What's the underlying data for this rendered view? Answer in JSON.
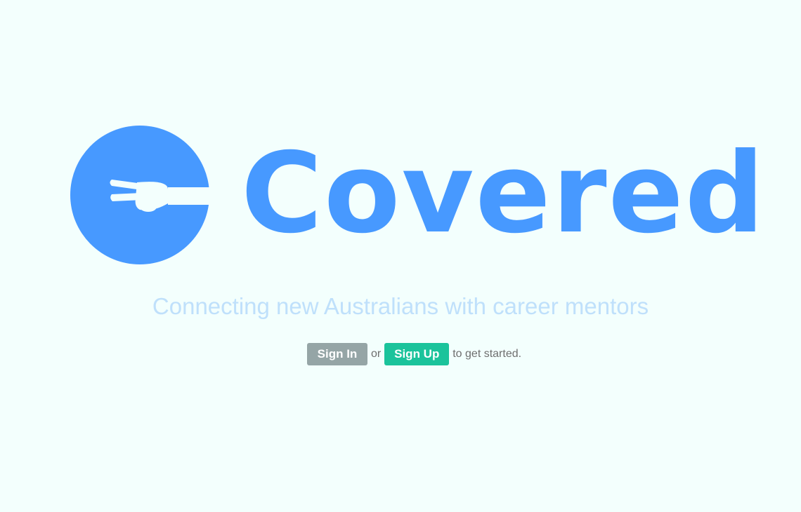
{
  "brand": {
    "name": "Covered",
    "logo_icon": "circle-hand-peace-icon",
    "color": "#4799ff"
  },
  "hero": {
    "tagline": "Connecting new Australians with career mentors",
    "tagline_color": "#bfe0fb"
  },
  "cta": {
    "signin_label": "Sign In",
    "signin_color": "#95a5a6",
    "or_text": "or",
    "signup_label": "Sign Up",
    "signup_color": "#1bc39b",
    "suffix_text": "to get started."
  },
  "background_color": "#f3fffd"
}
